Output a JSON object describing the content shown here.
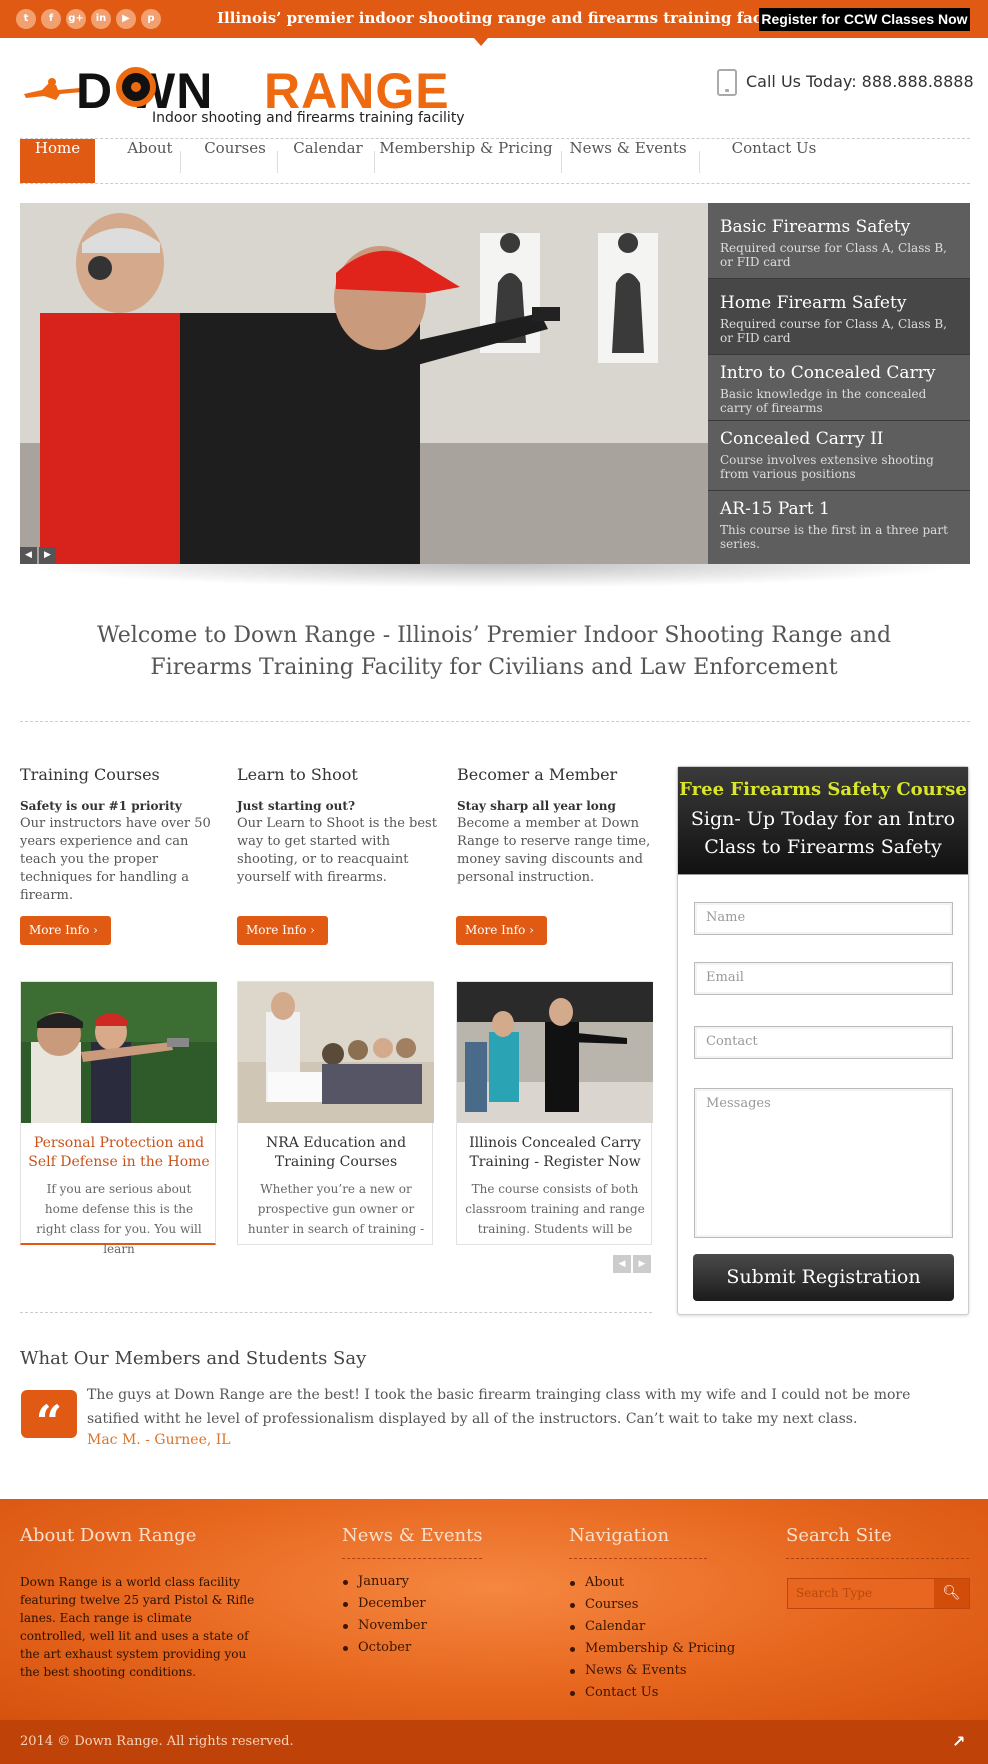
{
  "topbar": {
    "social_icons": [
      "twitter-icon",
      "facebook-icon",
      "google-plus-icon",
      "linkedin-icon",
      "youtube-icon",
      "pinterest-icon"
    ],
    "social_glyphs": [
      "t",
      "f",
      "g+",
      "in",
      "▶",
      "p"
    ],
    "tagline": "Illinois’ premier indoor shooting range and firearms training facility",
    "ccw_button": "Register for CCW Classes Now"
  },
  "header": {
    "logo_down": "D   WN",
    "logo_range": "RANGE",
    "logo_sub": "Indoor shooting and firearms training facility",
    "phone": "Call Us Today: 888.888.8888"
  },
  "nav": {
    "items": [
      "Home",
      "About",
      "Courses",
      "Calendar",
      "Membership & Pricing",
      "News & Events",
      "Contact Us"
    ],
    "active": "Home"
  },
  "slider": {
    "items": [
      {
        "title": "Basic Firearms Safety",
        "desc": "Required course for Class A, Class B, or FID card"
      },
      {
        "title": "Home Firearm Safety",
        "desc": "Required course for Class A, Class B, or FID card"
      },
      {
        "title": "Intro to Concealed Carry",
        "desc": "Basic knowledge in the concealed carry of firearms"
      },
      {
        "title": "Concealed Carry II",
        "desc": "Course involves extensive shooting from various positions"
      },
      {
        "title": "AR-15 Part 1",
        "desc": "This course is the first in a three part series."
      }
    ],
    "prev": "◀",
    "next": "▶"
  },
  "welcome": "Welcome to Down Range - Illinois’ Premier Indoor Shooting Range and Firearms Training Facility for Civilians and Law Enforcement",
  "features": [
    {
      "title": "Training Courses",
      "strong": "Safety is our #1 priority",
      "text": "Our instructors have over 50 years experience and can teach you the proper techniques for handling a firearm.",
      "button": "More Info  ›"
    },
    {
      "title": "Learn to Shoot",
      "strong": "Just starting out?",
      "text": "Our Learn to Shoot is the best way to get started with shooting, or to reacquaint yourself with firearms.",
      "button": "More Info  ›"
    },
    {
      "title": "Becomer a Member",
      "strong": "Stay sharp all year long",
      "text": "Become a member at Down Range to reserve range time, money saving discounts and personal instruction.",
      "button": "More Info  ›"
    }
  ],
  "cards": [
    {
      "title": "Personal Protection and Self Defense in the Home",
      "text": "If you are serious about home defense this is the right class for you. You will learn",
      "color": "#c8521a"
    },
    {
      "title": "NRA Education and Training Courses",
      "text": "Whether you’re a new or prospective gun owner or hunter in search of training -",
      "color": "#333333"
    },
    {
      "title": "Illinois Concealed Carry Training - Register Now",
      "text": "The course consists of both classroom training and range training. Students will be",
      "color": "#333333"
    }
  ],
  "form": {
    "free": "Free Firearms Safety Course",
    "signup": "Sign- Up Today for an Intro Class to Firearms Safety",
    "name_placeholder": "Name",
    "email_placeholder": "Email",
    "contact_placeholder": "Contact",
    "messages_placeholder": "Messages",
    "submit": "Submit Registration"
  },
  "testimonial": {
    "heading": "What Our Members and Students Say",
    "quote_glyph": "“",
    "text": "The guys at Down Range are the best! I took the basic firearm trainging class with my wife and I could not be more satified witht he level of professionalism displayed by all of the instructors. Can’t wait to take my next class.",
    "author": "Mac M. - Gurnee, IL"
  },
  "footer": {
    "about_heading": "About Down Range",
    "about_text": "Down Range is a world class facility featuring twelve 25 yard Pistol  & Rifle lanes. Each range is climate controlled, well lit and uses a state of the art exhaust system providing you the best shooting conditions.",
    "news_heading": "News & Events",
    "news_items": [
      "January",
      "December",
      "November",
      "October"
    ],
    "nav_heading": "Navigation",
    "nav_items": [
      "About",
      "Courses",
      "Calendar",
      "Membership & Pricing",
      "News & Events",
      "Contact Us"
    ],
    "search_heading": "Search Site",
    "search_placeholder": "Search Type",
    "copyright": "2014 © Down Range. All rights reserved.",
    "to_top": "↗"
  },
  "colors": {
    "accent": "#e15a14",
    "dark": "#1c1c1c",
    "highlight": "#d9e62a"
  }
}
